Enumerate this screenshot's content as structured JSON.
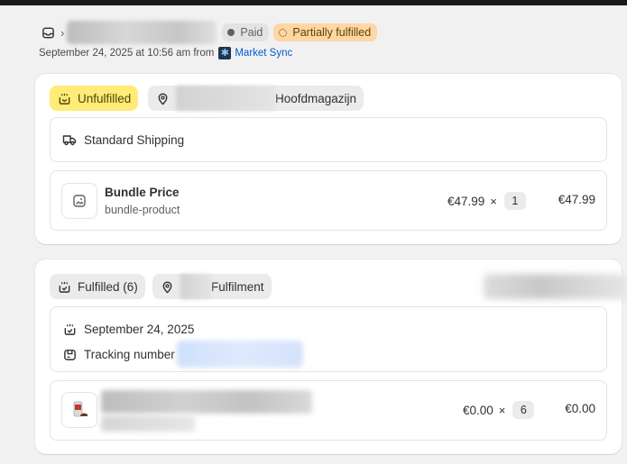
{
  "header": {
    "badges": {
      "paid": "Paid",
      "partially_fulfilled": "Partially fulfilled"
    },
    "meta": {
      "date_text": "September 24, 2025 at 10:56 am from",
      "source": "Market Sync"
    }
  },
  "unfulfilled_card": {
    "status_label": "Unfulfilled",
    "location_label": "Hoofdmagazijn",
    "shipping_method": "Standard Shipping",
    "item": {
      "name": "Bundle Price",
      "sku": "bundle-product",
      "unit_price": "€47.99",
      "times": "×",
      "quantity": "1",
      "total": "€47.99"
    }
  },
  "fulfilled_card": {
    "status_label": "Fulfilled (6)",
    "location_label": "Fulfilment",
    "date": "September 24, 2025",
    "tracking_label": "Tracking number",
    "item": {
      "unit_price": "€0.00",
      "times": "×",
      "quantity": "6",
      "total": "€0.00"
    }
  },
  "colors": {
    "unfulfilled": "#ffeb78",
    "partial": "#ffd6a4",
    "link": "#005bd3"
  }
}
